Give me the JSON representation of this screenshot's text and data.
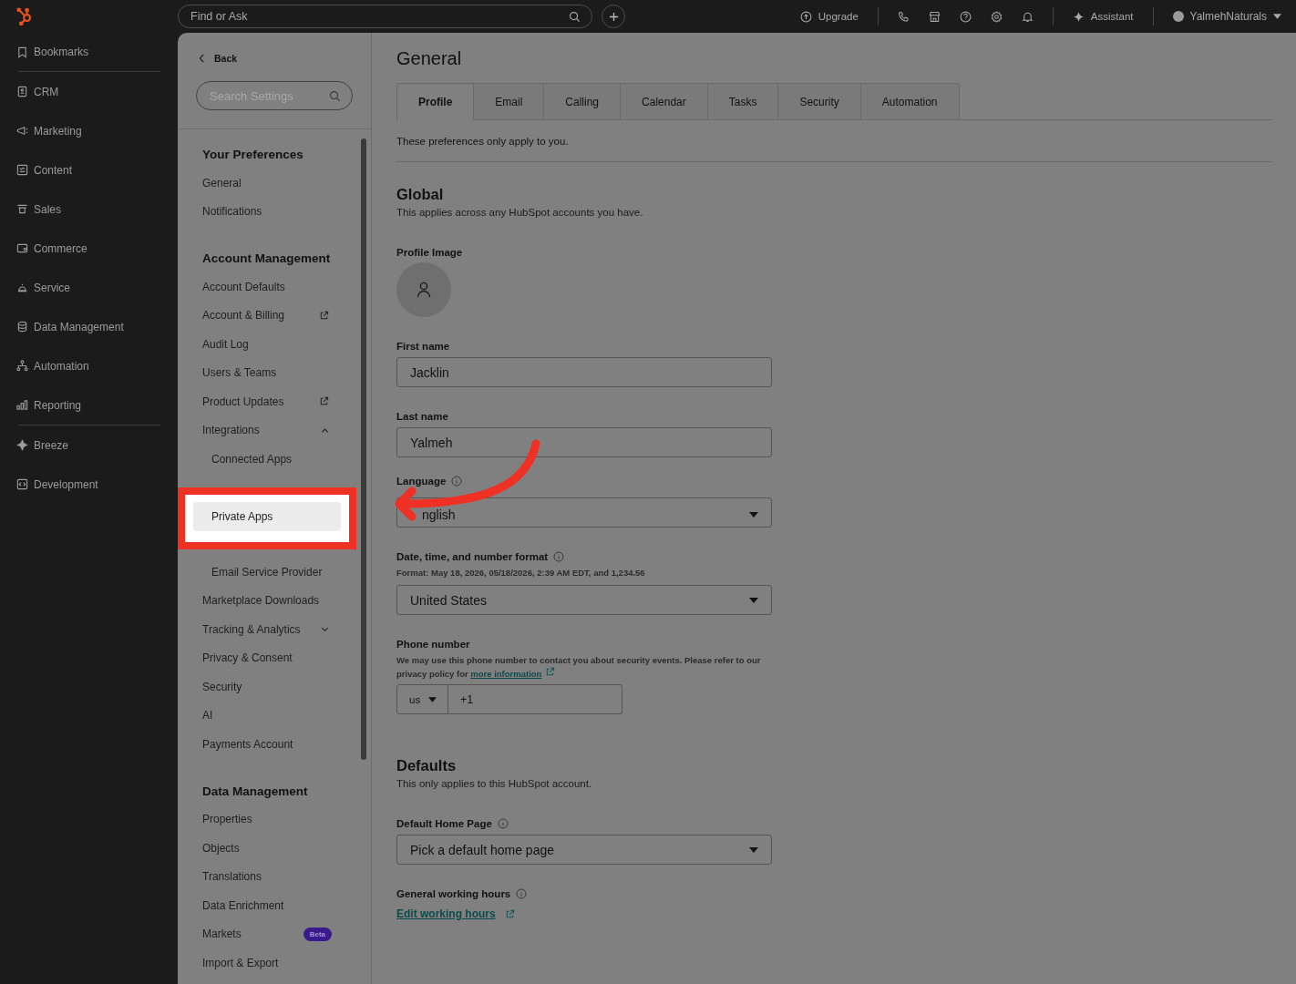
{
  "topbar": {
    "search_placeholder": "Find or Ask",
    "upgrade": "Upgrade",
    "assistant": "Assistant",
    "account": "YalmehNaturals"
  },
  "nav": {
    "bookmarks": "Bookmarks",
    "groups": [
      [
        "CRM",
        "Marketing",
        "Content",
        "Sales",
        "Commerce",
        "Service",
        "Data Management",
        "Automation",
        "Reporting"
      ],
      [
        "Breeze",
        "Development"
      ]
    ]
  },
  "settings_sidebar": {
    "back": "Back",
    "search_placeholder": "Search Settings",
    "sections": [
      {
        "title": "Your Preferences",
        "items": [
          {
            "label": "General",
            "selected": false
          },
          {
            "label": "Notifications",
            "selected": false
          }
        ]
      },
      {
        "title": "Account Management",
        "items": [
          {
            "label": "Account Defaults",
            "selected": false
          },
          {
            "label": "Account & Billing",
            "selected": false,
            "external": true
          },
          {
            "label": "Audit Log",
            "selected": false
          },
          {
            "label": "Users & Teams",
            "selected": false
          },
          {
            "label": "Product Updates",
            "selected": false,
            "external": true
          },
          {
            "label": "Integrations",
            "selected": false,
            "expanded": true,
            "children": [
              {
                "label": "Connected Apps",
                "selected": false
              },
              {
                "label": "Private Apps",
                "selected": true
              },
              {
                "label": "Email Service Provider",
                "selected": false
              }
            ]
          },
          {
            "label": "Marketplace Downloads",
            "selected": false
          },
          {
            "label": "Tracking & Analytics",
            "selected": false,
            "expanded": false
          },
          {
            "label": "Privacy & Consent",
            "selected": false
          },
          {
            "label": "Security",
            "selected": false
          },
          {
            "label": "AI",
            "selected": false
          },
          {
            "label": "Payments Account",
            "selected": false
          }
        ]
      },
      {
        "title": "Data Management",
        "items": [
          {
            "label": "Properties",
            "selected": false
          },
          {
            "label": "Objects",
            "selected": false
          },
          {
            "label": "Translations",
            "selected": false
          },
          {
            "label": "Data Enrichment",
            "selected": false
          },
          {
            "label": "Markets",
            "selected": false,
            "badge": "Beta"
          },
          {
            "label": "Import & Export",
            "selected": false
          }
        ]
      }
    ]
  },
  "page": {
    "title": "General",
    "tabs": [
      {
        "label": "Profile",
        "selected": true
      },
      {
        "label": "Email",
        "selected": false
      },
      {
        "label": "Calling",
        "selected": false
      },
      {
        "label": "Calendar",
        "selected": false
      },
      {
        "label": "Tasks",
        "selected": false
      },
      {
        "label": "Security",
        "selected": false
      },
      {
        "label": "Automation",
        "selected": false
      }
    ],
    "note": "These preferences only apply to you.",
    "sections": [
      {
        "title": "Global",
        "description": "This applies across any HubSpot accounts you have.",
        "fields": [
          {
            "kind": "avatar",
            "label": "Profile Image"
          },
          {
            "kind": "text",
            "label": "First name",
            "value": "Jacklin"
          },
          {
            "kind": "text",
            "label": "Last name",
            "value": "Yalmeh"
          },
          {
            "kind": "select",
            "label": "Language",
            "info": true,
            "value": "nglish"
          },
          {
            "kind": "select",
            "label": "Date, time, and number format",
            "info": true,
            "hint": "Format: May 18, 2026, 05/18/2026, 2:39 AM EDT, and 1,234.56",
            "value": "United States"
          },
          {
            "kind": "phone",
            "label": "Phone number",
            "hint": "We may use this phone number to contact you about security events. Please refer to our privacy policy for",
            "link": "more information",
            "country": "us",
            "value": "+1"
          }
        ]
      },
      {
        "title": "Defaults",
        "description": "This only applies to this HubSpot account.",
        "fields": [
          {
            "kind": "select",
            "label": "Default Home Page",
            "info": true,
            "placeholder": "Pick a default home page"
          },
          {
            "kind": "link",
            "label": "General working hours",
            "info": true,
            "link": "Edit working hours"
          }
        ]
      }
    ]
  }
}
